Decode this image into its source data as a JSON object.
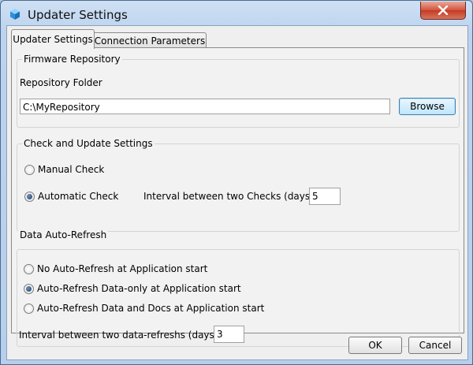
{
  "window": {
    "title": "Updater Settings",
    "icon": "app-cube-icon",
    "close_icon": "close-x-icon"
  },
  "tabs": [
    {
      "label": "Updater Settings",
      "active": true
    },
    {
      "label": "Connection Parameters",
      "active": false
    }
  ],
  "firmware": {
    "legend": "Firmware Repository",
    "folder_label": "Repository Folder",
    "folder_value": "C:\\MyRepository",
    "browse_label": "Browse"
  },
  "check": {
    "legend": "Check and Update Settings",
    "options": [
      {
        "label": "Manual Check",
        "selected": false
      },
      {
        "label": "Automatic Check",
        "selected": true
      }
    ],
    "interval_label": "Interval between two Checks (days)",
    "interval_value": "5"
  },
  "refresh": {
    "legend": "Data Auto-Refresh",
    "options": [
      {
        "label": "No Auto-Refresh at Application start",
        "selected": false
      },
      {
        "label": "Auto-Refresh Data-only at Application start",
        "selected": true
      },
      {
        "label": "Auto-Refresh Data and Docs at Application start",
        "selected": false
      }
    ],
    "interval_label": "Interval between two data-refreshs (days)",
    "interval_value": "3"
  },
  "buttons": {
    "ok": "OK",
    "cancel": "Cancel"
  },
  "colors": {
    "title_bar": "#bcd3ee",
    "close_button": "#c43b24",
    "focus_border": "#3c7fb1"
  }
}
